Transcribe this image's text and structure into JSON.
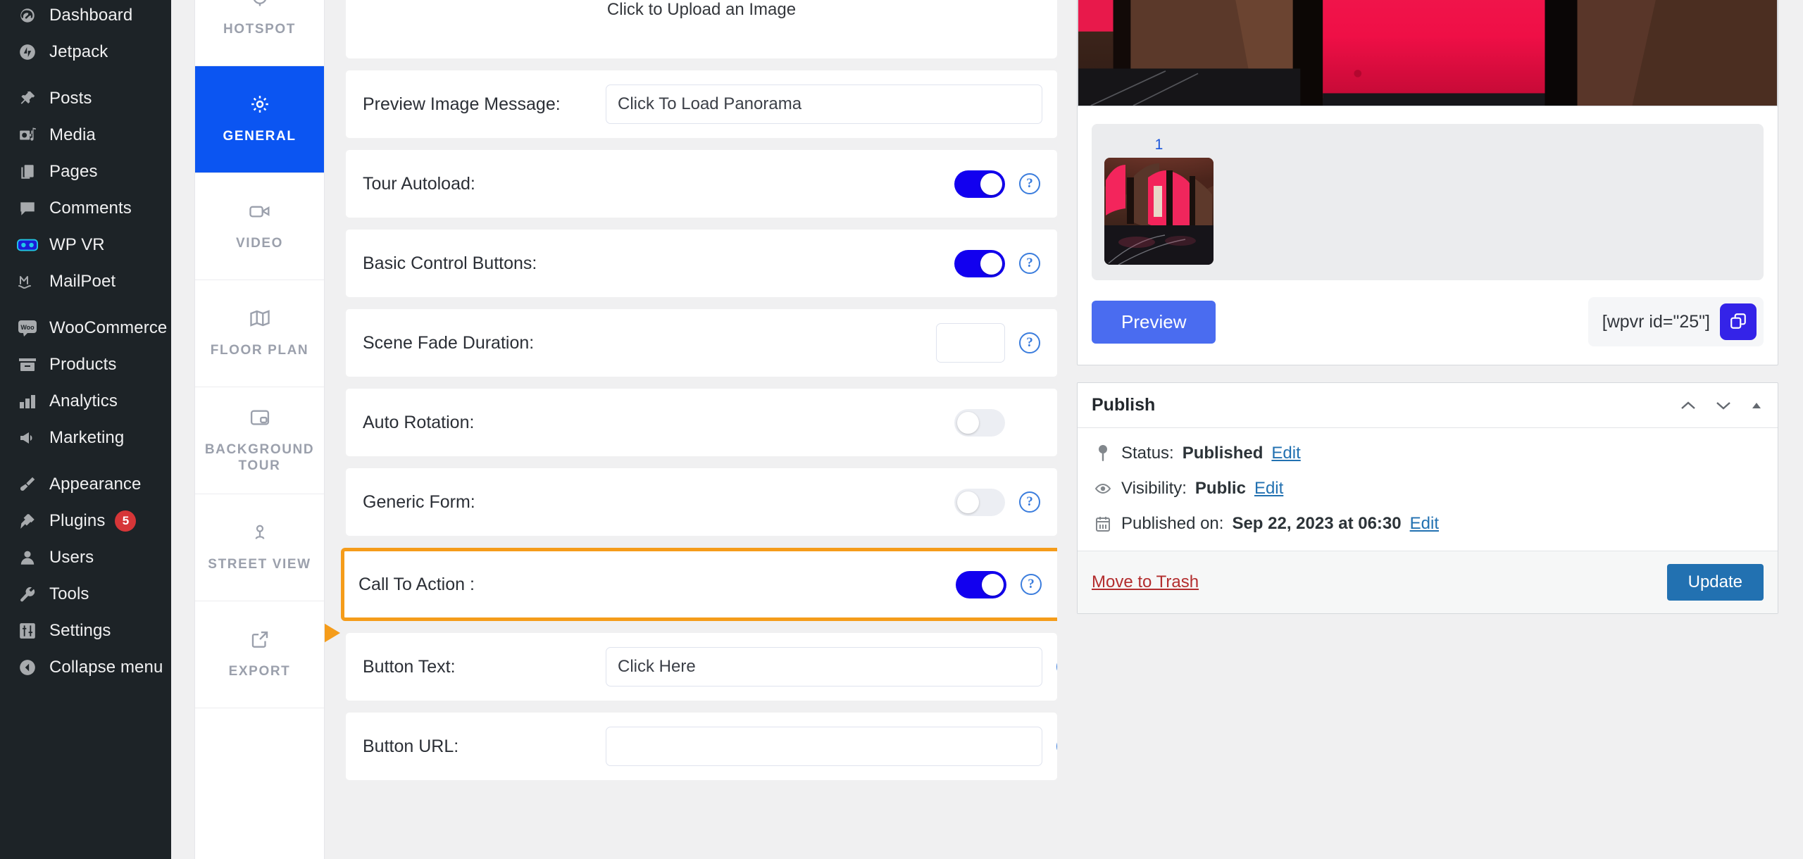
{
  "sidebar": {
    "items": [
      {
        "label": "Dashboard",
        "icon": "dashboard-icon",
        "badge": null
      },
      {
        "label": "Jetpack",
        "icon": "jetpack-icon",
        "badge": null
      },
      {
        "label": "Posts",
        "icon": "pin-icon",
        "badge": null
      },
      {
        "label": "Media",
        "icon": "media-icon",
        "badge": null
      },
      {
        "label": "Pages",
        "icon": "pages-icon",
        "badge": null
      },
      {
        "label": "Comments",
        "icon": "comment-icon",
        "badge": null
      },
      {
        "label": "WP VR",
        "icon": "vr-goggles-icon",
        "badge": null
      },
      {
        "label": "MailPoet",
        "icon": "mailpoet-icon",
        "badge": null
      },
      {
        "label": "WooCommerce",
        "icon": "woo-icon",
        "badge": null
      },
      {
        "label": "Products",
        "icon": "products-icon",
        "badge": null
      },
      {
        "label": "Analytics",
        "icon": "bar-chart-icon",
        "badge": null
      },
      {
        "label": "Marketing",
        "icon": "megaphone-icon",
        "badge": null
      },
      {
        "label": "Appearance",
        "icon": "paintbrush-icon",
        "badge": null
      },
      {
        "label": "Plugins",
        "icon": "plug-icon",
        "badge": "5"
      },
      {
        "label": "Users",
        "icon": "user-icon",
        "badge": null
      },
      {
        "label": "Tools",
        "icon": "wrench-icon",
        "badge": null
      },
      {
        "label": "Settings",
        "icon": "sliders-icon",
        "badge": null
      },
      {
        "label": "Collapse menu",
        "icon": "collapse-icon",
        "badge": null
      }
    ]
  },
  "tabs": [
    {
      "label": "HOTSPOT",
      "icon": "hotspot-icon",
      "active": false
    },
    {
      "label": "GENERAL",
      "icon": "gear-icon",
      "active": true
    },
    {
      "label": "VIDEO",
      "icon": "video-icon",
      "active": false
    },
    {
      "label": "FLOOR PLAN",
      "icon": "map-icon",
      "active": false
    },
    {
      "label": "BACKGROUND TOUR",
      "icon": "pip-icon",
      "active": false
    },
    {
      "label": "STREET VIEW",
      "icon": "map-pin-icon",
      "active": false
    },
    {
      "label": "EXPORT",
      "icon": "external-link-icon",
      "active": false
    }
  ],
  "settings": {
    "upload_message": "Click to Upload an Image",
    "rows": [
      {
        "label": "Preview Image Message:",
        "type": "text",
        "value": "Click To Load Panorama",
        "width": "wide",
        "help": false
      },
      {
        "label": "Tour Autoload:",
        "type": "toggle",
        "value": "on",
        "help": true
      },
      {
        "label": "Basic Control Buttons:",
        "type": "toggle",
        "value": "on",
        "help": true
      },
      {
        "label": "Scene Fade Duration:",
        "type": "text",
        "value": "",
        "width": "small",
        "help": true
      },
      {
        "label": "Auto Rotation:",
        "type": "toggle",
        "value": "off",
        "help": false
      },
      {
        "label": "Generic Form:",
        "type": "toggle",
        "value": "off",
        "help": true
      },
      {
        "label": "Call To Action :",
        "type": "toggle",
        "value": "on",
        "help": true,
        "highlight": true
      },
      {
        "label": "Button Text:",
        "type": "text",
        "value": "Click Here",
        "width": "mid",
        "help": true
      },
      {
        "label": "Button URL:",
        "type": "text",
        "value": "",
        "width": "mid",
        "help": true
      }
    ]
  },
  "tour_panel": {
    "scene_number": "1",
    "preview_button": "Preview",
    "shortcode": "[wpvr id=\"25\"]",
    "copy_icon": "copy-icon"
  },
  "publish": {
    "title": "Publish",
    "status_label": "Status:",
    "status_value": "Published",
    "status_edit": "Edit",
    "visibility_label": "Visibility:",
    "visibility_value": "Public",
    "visibility_edit": "Edit",
    "published_label": "Published on:",
    "published_value": "Sep 22, 2023 at 06:30",
    "published_edit": "Edit",
    "trash_label": "Move to Trash",
    "update_label": "Update"
  },
  "colors": {
    "accent_blue": "#0b55f2",
    "toggle_on": "#1200ef",
    "highlight_orange": "#f59c1a",
    "wp_blue": "#2271b1",
    "trash_red": "#b32d2e",
    "badge_red": "#d63638",
    "sidebar_bg": "#1d2327"
  }
}
